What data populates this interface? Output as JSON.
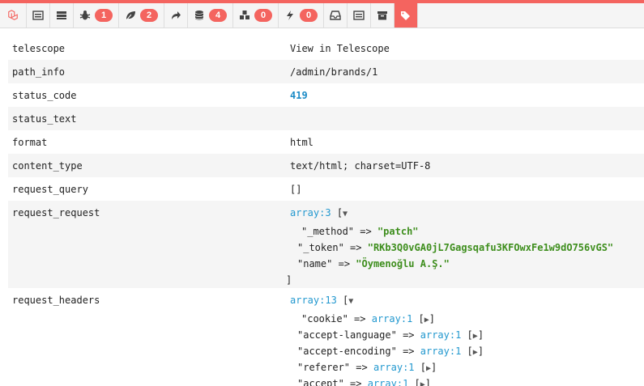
{
  "toolbar": {
    "items": [
      {
        "name": "laravel-logo",
        "badge": null
      },
      {
        "name": "request-icon",
        "badge": null
      },
      {
        "name": "timeline-icon",
        "badge": null
      },
      {
        "name": "bug-icon",
        "badge": "1"
      },
      {
        "name": "leaf-icon",
        "badge": "2"
      },
      {
        "name": "share-icon",
        "badge": null
      },
      {
        "name": "database-icon",
        "badge": "4"
      },
      {
        "name": "cubes-icon",
        "badge": "0"
      },
      {
        "name": "bolt-icon",
        "badge": "0"
      },
      {
        "name": "inbox-icon",
        "badge": null
      },
      {
        "name": "list-icon",
        "badge": null
      },
      {
        "name": "archive-icon",
        "badge": null
      },
      {
        "name": "tags-icon",
        "badge": null,
        "active": true
      }
    ]
  },
  "rows": {
    "telescope": {
      "key": "telescope",
      "value": "View in Telescope"
    },
    "path_info": {
      "key": "path_info",
      "value": "/admin/brands/1"
    },
    "status_code": {
      "key": "status_code",
      "value": "419"
    },
    "status_text": {
      "key": "status_text",
      "value": ""
    },
    "format": {
      "key": "format",
      "value": "html"
    },
    "content_type": {
      "key": "content_type",
      "value": "text/html; charset=UTF-8"
    },
    "request_query": {
      "key": "request_query",
      "value": "[]"
    },
    "request_request": {
      "key": "request_request",
      "header": "array:3",
      "open": "[",
      "entries": [
        {
          "k": "\"_method\"",
          "v": "\"patch\""
        },
        {
          "k": "\"_token\"",
          "v": "\"RKb3Q0vGA0jL7Gagsqafu3KFOwxFe1w9dO756vGS\""
        },
        {
          "k": "\"name\"",
          "v": "\"Öymenoğlu A.Ş.\""
        }
      ],
      "close": "]"
    },
    "request_headers": {
      "key": "request_headers",
      "header": "array:13",
      "open": "[",
      "entries": [
        {
          "k": "\"cookie\"",
          "v": "array:1"
        },
        {
          "k": "\"accept-language\"",
          "v": "array:1"
        },
        {
          "k": "\"accept-encoding\"",
          "v": "array:1"
        },
        {
          "k": "\"referer\"",
          "v": "array:1"
        },
        {
          "k": "\"accept\"",
          "v": "array:1"
        }
      ]
    }
  },
  "arrow": "=>",
  "colors": {
    "accent": "#f4645f",
    "link": "#2298cf",
    "string_green": "#3e8e1d"
  }
}
